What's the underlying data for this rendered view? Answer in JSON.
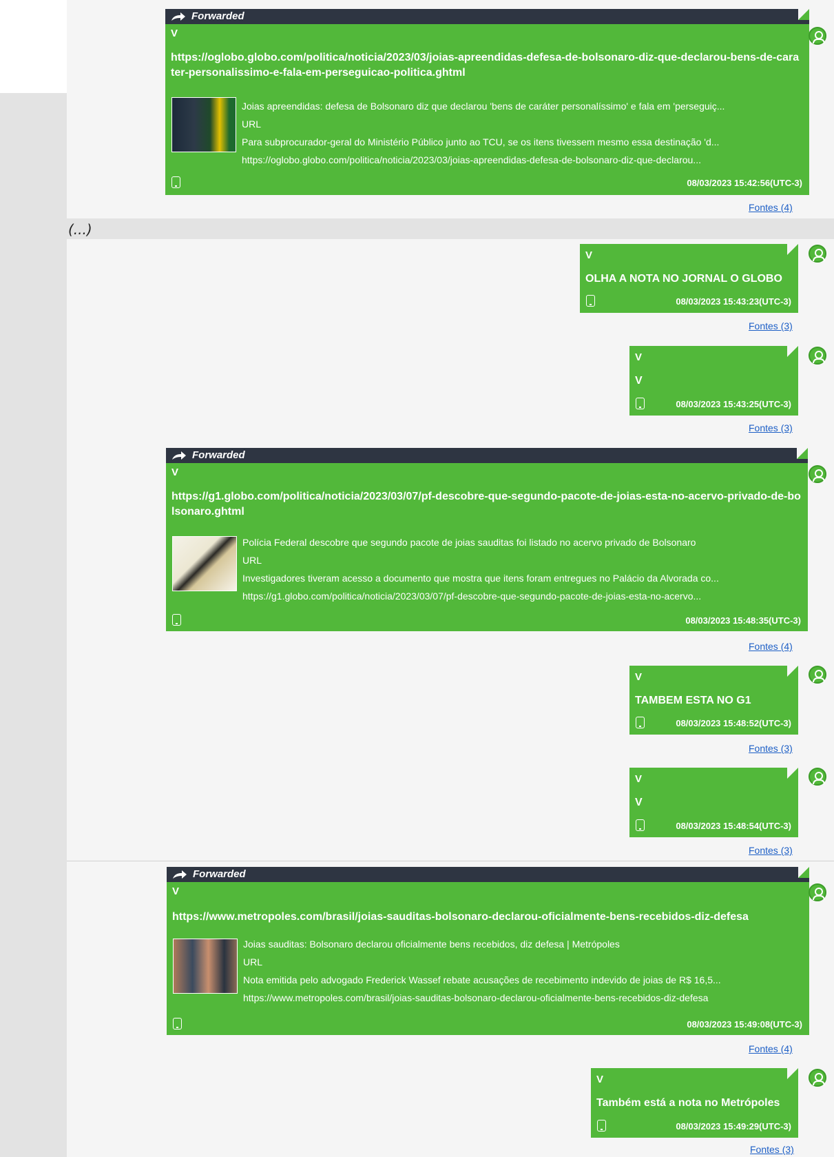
{
  "page": {
    "ellipsis": "(...)"
  },
  "colors": {
    "bubble": "#52b83a",
    "forward_bar": "#2e3542",
    "link": "#1d5fc6",
    "side_panel": "#e3e3e3"
  },
  "icons": {
    "forward": "forward-arrow-icon",
    "device": "mobile-device-icon",
    "avatar": "user-avatar-icon"
  },
  "messages": [
    {
      "forwarded_label": "Forwarded",
      "sender": "V",
      "link_text": "https://oglobo.globo.com/politica/noticia/2023/03/joias-apreendidas-defesa-de-bolsonaro-diz-que-declarou-bens-de-carater-personalissimo-e-fala-em-perseguicao-politica.ghtml",
      "preview": {
        "title": "Joias apreendidas: defesa de Bolsonaro diz que declarou 'bens de caráter personalíssimo' e fala em 'perseguiç...",
        "type": "URL",
        "description": "Para subprocurador-geral do Ministério Público junto ao TCU, se os itens tivessem mesmo essa destinação 'd...",
        "url": "https://oglobo.globo.com/politica/noticia/2023/03/joias-apreendidas-defesa-de-bolsonaro-diz-que-declarou..."
      },
      "timestamp": "08/03/2023 15:42:56(UTC-3)",
      "fontes": "Fontes (4)"
    },
    {
      "sender": "V",
      "text": "OLHA A NOTA NO JORNAL O GLOBO",
      "timestamp": "08/03/2023 15:43:23(UTC-3)",
      "fontes": "Fontes (3)"
    },
    {
      "sender": "V",
      "text": "V",
      "timestamp": "08/03/2023 15:43:25(UTC-3)",
      "fontes": "Fontes (3)"
    },
    {
      "forwarded_label": "Forwarded",
      "sender": "V",
      "link_text": "https://g1.globo.com/politica/noticia/2023/03/07/pf-descobre-que-segundo-pacote-de-joias-esta-no-acervo-privado-de-bolsonaro.ghtml",
      "preview": {
        "title": "Polícia Federal descobre que segundo pacote de joias sauditas foi listado no acervo privado de Bolsonaro",
        "type": "URL",
        "description": "Investigadores tiveram acesso a documento que mostra que itens foram entregues no Palácio da Alvorada co...",
        "url": "https://g1.globo.com/politica/noticia/2023/03/07/pf-descobre-que-segundo-pacote-de-joias-esta-no-acervo..."
      },
      "timestamp": "08/03/2023 15:48:35(UTC-3)",
      "fontes": "Fontes (4)"
    },
    {
      "sender": "V",
      "text": "TAMBEM ESTA NO G1",
      "timestamp": "08/03/2023 15:48:52(UTC-3)",
      "fontes": "Fontes (3)"
    },
    {
      "sender": "V",
      "text": "V",
      "timestamp": "08/03/2023 15:48:54(UTC-3)",
      "fontes": "Fontes (3)"
    },
    {
      "forwarded_label": "Forwarded",
      "sender": "V",
      "link_text": "https://www.metropoles.com/brasil/joias-sauditas-bolsonaro-declarou-oficialmente-bens-recebidos-diz-defesa",
      "preview": {
        "title": "Joias sauditas: Bolsonaro declarou oficialmente bens recebidos, diz defesa | Metrópoles",
        "type": "URL",
        "description": "Nota emitida pelo advogado Frederick Wassef rebate acusações de recebimento indevido de joias de R$ 16,5...",
        "url": "https://www.metropoles.com/brasil/joias-sauditas-bolsonaro-declarou-oficialmente-bens-recebidos-diz-defesa"
      },
      "timestamp": "08/03/2023 15:49:08(UTC-3)",
      "fontes": "Fontes (4)"
    },
    {
      "sender": "V",
      "text": "Também está a nota no Metrópoles",
      "timestamp": "08/03/2023 15:49:29(UTC-3)",
      "fontes": "Fontes (3)"
    }
  ]
}
